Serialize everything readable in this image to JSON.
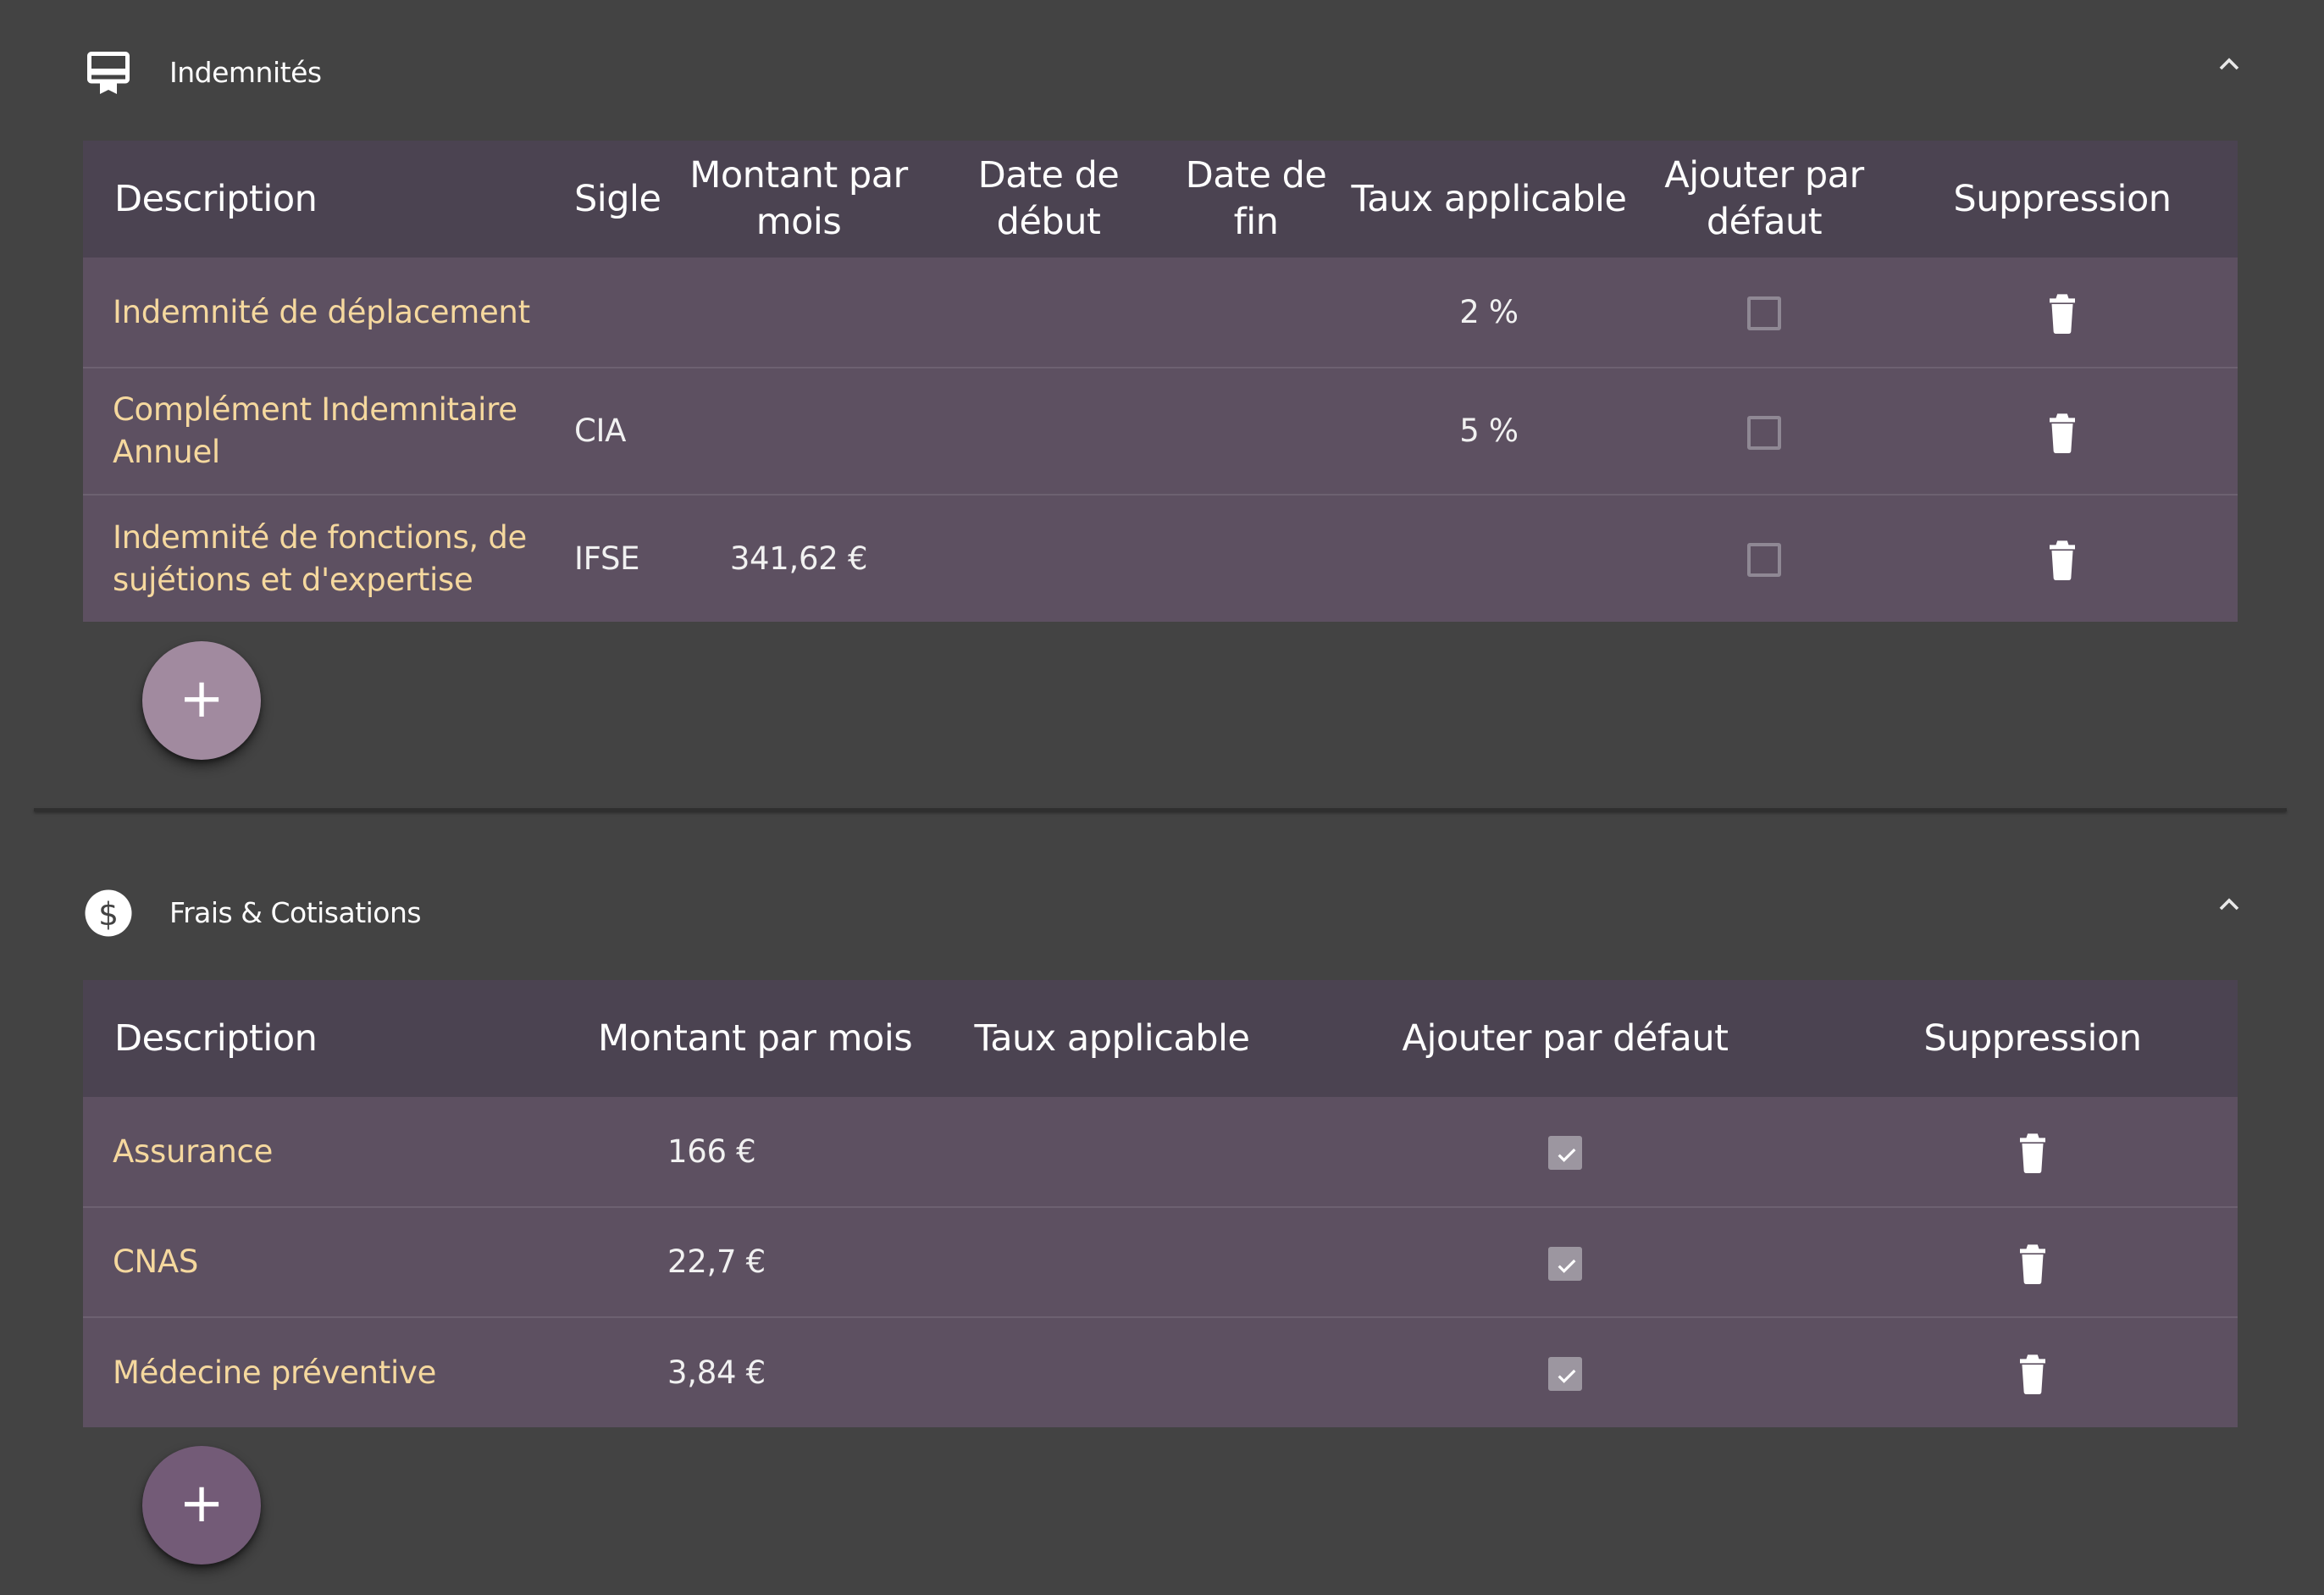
{
  "indemnites": {
    "title": "Indemnités",
    "icon": "card-membership-icon",
    "headers": {
      "description": "Description",
      "sigle": "Sigle",
      "montant": "Montant par mois",
      "date_debut": "Date de début",
      "date_fin": "Date de fin",
      "taux": "Taux applicable",
      "ajouter": "Ajouter par défaut",
      "suppression": "Suppression"
    },
    "rows": [
      {
        "description": "Indemnité de déplacement",
        "sigle": "",
        "montant": "",
        "date_debut": "",
        "date_fin": "",
        "taux": "2 %",
        "ajouter": false
      },
      {
        "description": "Complément Indemnitaire Annuel",
        "sigle": "CIA",
        "montant": "",
        "date_debut": "",
        "date_fin": "",
        "taux": "5 %",
        "ajouter": false
      },
      {
        "description": "Indemnité de fonctions, de sujétions et d'expertise",
        "sigle": "IFSE",
        "montant": "341,62 €",
        "date_debut": "",
        "date_fin": "",
        "taux": "",
        "ajouter": false
      }
    ],
    "add_label": "+",
    "add_color": "#a18a9f"
  },
  "frais": {
    "title": "Frais & Cotisations",
    "icon": "dollar-circle-icon",
    "headers": {
      "description": "Description",
      "montant": "Montant par mois",
      "taux": "Taux applicable",
      "ajouter": "Ajouter par défaut",
      "suppression": "Suppression"
    },
    "rows": [
      {
        "description": "Assurance",
        "montant": "166 €",
        "taux": "",
        "ajouter": true
      },
      {
        "description": "CNAS",
        "montant": "22,7 €",
        "taux": "",
        "ajouter": true
      },
      {
        "description": "Médecine préventive",
        "montant": "3,84 €",
        "taux": "",
        "ajouter": true
      }
    ],
    "add_label": "+",
    "add_color": "#735b77"
  },
  "colors": {
    "background": "#434343",
    "header_row": "#4b4351",
    "body_row": "#5d5061",
    "description_text": "#f5d89e"
  }
}
